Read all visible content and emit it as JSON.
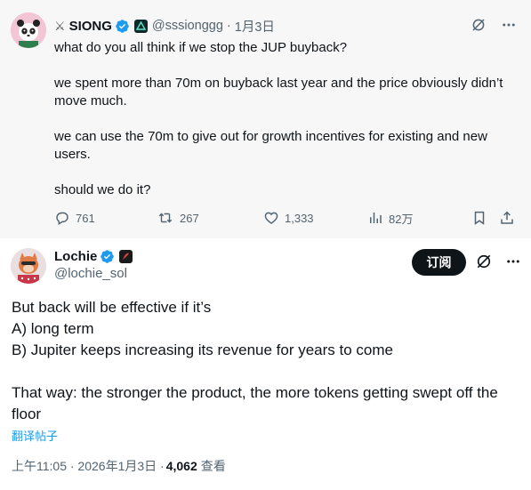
{
  "colors": {
    "accent": "#1d9bf0",
    "muted": "#536471",
    "text": "#0f1419",
    "parent_bg": "#f7f7f7"
  },
  "parent_tweet": {
    "name": "SIONG",
    "name_prefix_icon": "crossed-swords-icon",
    "handle": "@sssionggg",
    "separator": "·",
    "time": "1月3日",
    "body": [
      "what do you all think if we stop the JUP buyback?",
      "we spent more than 70m on buyback last year and the price obviously didn’t move much.",
      "we can use the 70m to give out for growth incentives for existing and new users.",
      "should we do it?"
    ],
    "actions": {
      "replies": "761",
      "reposts": "267",
      "likes": "1,333",
      "views": "82万"
    }
  },
  "main_tweet": {
    "name": "Lochie",
    "handle": "@lochie_sol",
    "subscribe_label": "订阅",
    "body": [
      "But back will be effective if it’s",
      "A) long term",
      "B) Jupiter keeps increasing its revenue for years to come",
      "",
      "That way: the stronger the product, the more tokens getting swept off the floor"
    ],
    "translate_label": "翻译帖子",
    "timestamp": "上午11:05 · 2026年1月3日 · ",
    "views_count": "4,062",
    "views_label": "查看"
  }
}
